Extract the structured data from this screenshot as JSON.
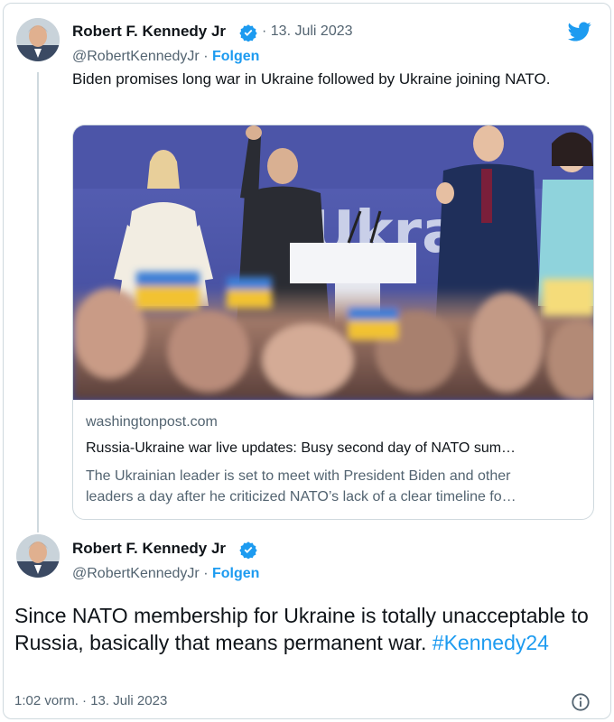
{
  "tweet1": {
    "author_name": "Robert F. Kennedy Jr",
    "date": "13. Juli 2023",
    "handle": "@RobertKennedyJr",
    "follow_label": "Folgen",
    "separator": "·",
    "text": "Biden promises long war in Ukraine followed by Ukraine joining NATO.",
    "card": {
      "image_caption_visible": "Ukra",
      "domain": "washingtonpost.com",
      "title": "Russia-Ukraine war live updates: Busy second day of NATO sum…",
      "description_line1": "The Ukrainian leader is set to meet with President Biden and other",
      "description_line2": "leaders a day after he criticized NATO’s lack of a clear timeline fo…"
    }
  },
  "tweet2": {
    "author_name": "Robert F. Kennedy Jr",
    "handle": "@RobertKennedyJr",
    "follow_label": "Folgen",
    "separator": "·",
    "text": "Since NATO membership for Ukraine is totally unacceptable to Russia, basically that means permanent war.",
    "hashtag": "#Kennedy24",
    "time": "1:02 vorm.",
    "date": "13. Juli 2023"
  },
  "icons": {
    "verified": "verified-badge-icon",
    "brand": "twitter-bird-icon",
    "info": "info-icon"
  },
  "colors": {
    "accent": "#1d9bf0",
    "text": "#0f1419",
    "secondary": "#536471",
    "border": "#cfd9de"
  }
}
